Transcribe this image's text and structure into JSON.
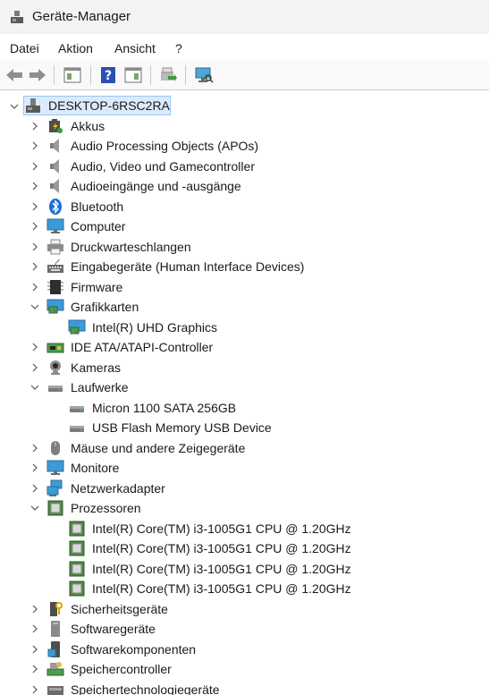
{
  "window": {
    "title": "Geräte-Manager"
  },
  "menu": [
    "Datei",
    "Aktion",
    "Ansicht",
    "?"
  ],
  "toolbar": {
    "buttons": [
      "back-icon",
      "forward-icon",
      "properties-icon",
      "help-icon",
      "view-pane-icon",
      "update-driver-icon",
      "scan-hardware-icon"
    ]
  },
  "tree": {
    "root": "DESKTOP-6RSC2RA",
    "items": [
      {
        "label": "Akkus",
        "icon": "battery-icon",
        "expanded": false
      },
      {
        "label": "Audio Processing Objects (APOs)",
        "icon": "speaker-icon",
        "expanded": false
      },
      {
        "label": "Audio, Video und Gamecontroller",
        "icon": "speaker-icon",
        "expanded": false
      },
      {
        "label": "Audioeingänge und -ausgänge",
        "icon": "speaker-icon",
        "expanded": false
      },
      {
        "label": "Bluetooth",
        "icon": "bluetooth-icon",
        "expanded": false
      },
      {
        "label": "Computer",
        "icon": "monitor-icon",
        "expanded": false
      },
      {
        "label": "Druckwarteschlangen",
        "icon": "printer-icon",
        "expanded": false
      },
      {
        "label": "Eingabegeräte (Human Interface Devices)",
        "icon": "hid-icon",
        "expanded": false
      },
      {
        "label": "Firmware",
        "icon": "firmware-chip-icon",
        "expanded": false
      },
      {
        "label": "Grafikkarten",
        "icon": "display-adapter-icon",
        "expanded": true,
        "children": [
          "Intel(R) UHD Graphics"
        ]
      },
      {
        "label": "IDE ATA/ATAPI-Controller",
        "icon": "ide-controller-icon",
        "expanded": false
      },
      {
        "label": "Kameras",
        "icon": "camera-icon",
        "expanded": false
      },
      {
        "label": "Laufwerke",
        "icon": "drive-icon",
        "expanded": true,
        "children": [
          "Micron 1100 SATA 256GB",
          "USB Flash Memory USB Device"
        ]
      },
      {
        "label": "Mäuse und andere Zeigegeräte",
        "icon": "mouse-icon",
        "expanded": false
      },
      {
        "label": "Monitore",
        "icon": "monitor-icon",
        "expanded": false
      },
      {
        "label": "Netzwerkadapter",
        "icon": "network-icon",
        "expanded": false
      },
      {
        "label": "Prozessoren",
        "icon": "cpu-icon",
        "expanded": true,
        "children": [
          "Intel(R) Core(TM) i3-1005G1 CPU @ 1.20GHz",
          "Intel(R) Core(TM) i3-1005G1 CPU @ 1.20GHz",
          "Intel(R) Core(TM) i3-1005G1 CPU @ 1.20GHz",
          "Intel(R) Core(TM) i3-1005G1 CPU @ 1.20GHz"
        ]
      },
      {
        "label": "Sicherheitsgeräte",
        "icon": "security-key-icon",
        "expanded": false
      },
      {
        "label": "Softwaregeräte",
        "icon": "software-device-icon",
        "expanded": false
      },
      {
        "label": "Softwarekomponenten",
        "icon": "software-component-icon",
        "expanded": false
      },
      {
        "label": "Speichercontroller",
        "icon": "storage-controller-icon",
        "expanded": false
      },
      {
        "label": "Speichertechnologiegeräte",
        "icon": "storage-tech-icon",
        "expanded": false
      }
    ]
  },
  "colors": {
    "accent": "#0a64d8",
    "selection": "#dcebfc"
  }
}
